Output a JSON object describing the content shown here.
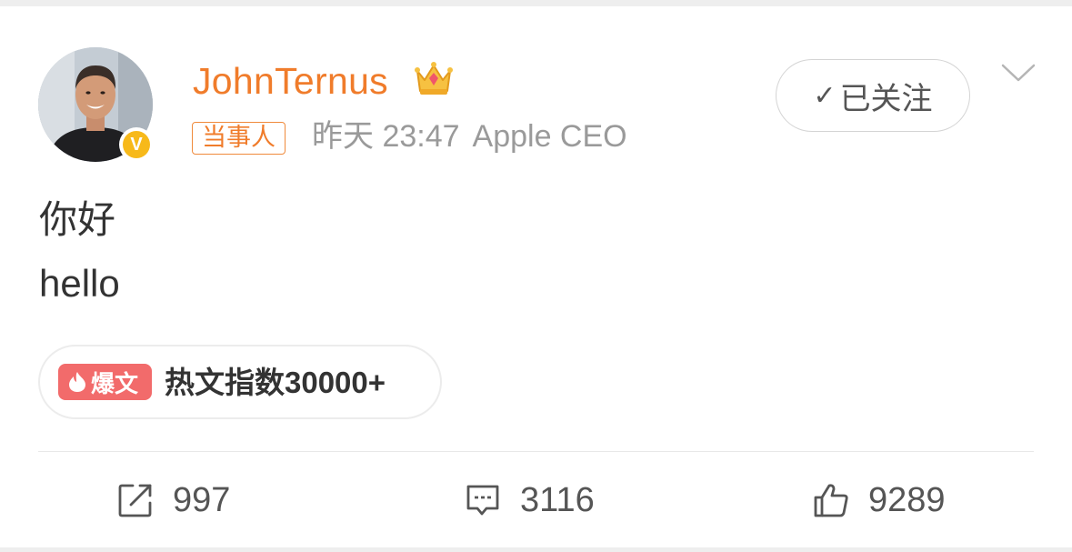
{
  "post": {
    "author": {
      "name": "JohnTernus",
      "crown_icon": "crown-icon",
      "verified_mark": "V",
      "tag": "当事人"
    },
    "time": "昨天 23:47",
    "source": "Apple CEO",
    "follow": {
      "label": "已关注",
      "check": "✓"
    },
    "content": {
      "line1": "你好",
      "line2": "hello"
    },
    "hot": {
      "badge": "爆文",
      "text": "热文指数30000+"
    },
    "actions": {
      "repost_count": "997",
      "comment_count": "3116",
      "like_count": "9289"
    }
  },
  "colors": {
    "accent": "#f07c2b",
    "verified": "#f7b91a",
    "hot_badge": "#f26b6b",
    "meta_gray": "#9a9a9a",
    "text": "#333333"
  }
}
